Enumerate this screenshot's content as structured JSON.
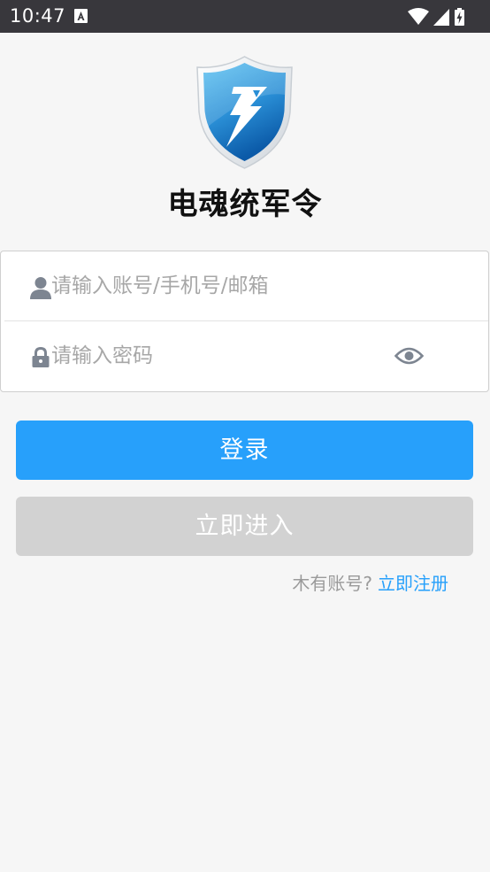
{
  "status_bar": {
    "time": "10:47",
    "icons": [
      "text-notification-icon",
      "wifi-icon",
      "signal-icon",
      "battery-charging-icon"
    ]
  },
  "app": {
    "title": "电魂统军令",
    "logo_icon": "shield-lightning-logo"
  },
  "login_form": {
    "account_placeholder": "请输入账号/手机号/邮箱",
    "account_value": "",
    "password_placeholder": "请输入密码",
    "password_value": "",
    "account_icon": "person-icon",
    "password_icon": "lock-icon",
    "toggle_icon": "eye-icon"
  },
  "buttons": {
    "login_label": "登录",
    "enter_label": "立即进入"
  },
  "register": {
    "prompt": "木有账号?",
    "link": "立即注册"
  },
  "colors": {
    "accent": "#27a0fb",
    "disabled_button": "#d2d2d2",
    "background": "#f6f6f6",
    "status_bar": "#38373c"
  }
}
